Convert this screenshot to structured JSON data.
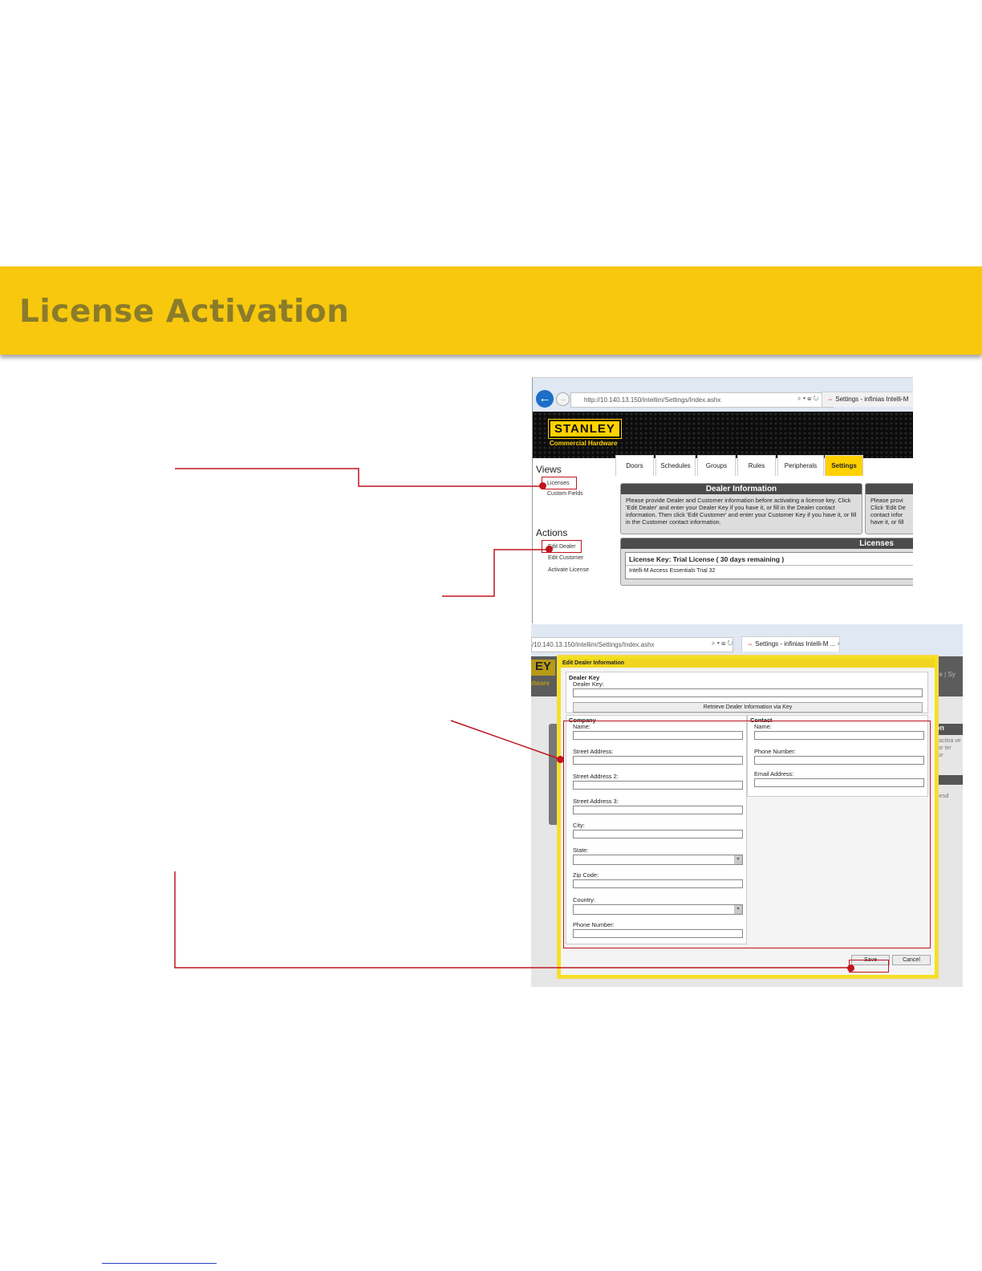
{
  "banner": {
    "title": "License Activation"
  },
  "screen1": {
    "address": "http://10.140.13.150/intellim/Settings/Index.ashx",
    "address_host": "10.140.13.150",
    "tab_title": "Settings - infinias Intelli-M",
    "logo": "STANLEY",
    "logo_sub": "Commercial Hardware",
    "views_heading": "Views",
    "views_items": [
      "Licenses",
      "Custom Fields"
    ],
    "actions_heading": "Actions",
    "actions_items": [
      "Edit Dealer",
      "Edit Customer",
      "Activate License"
    ],
    "nav_tabs": [
      "Doors",
      "Schedules",
      "Groups",
      "Rules",
      "Peripherals",
      "Settings"
    ],
    "active_tab": "Settings",
    "dealer_panel": {
      "title": "Dealer Information",
      "text": "Please provide Dealer and Customer information before activating a license key. Click 'Edit Dealer' and enter your Dealer Key if you have it, or fill in the Dealer contact information. Then click 'Edit Customer' and enter your Customer Key if you have it, or fill in the Customer contact information."
    },
    "customer_panel_text": "Please provi Click 'Edit De contact infor have it, or fill",
    "licenses_panel": {
      "title": "Licenses",
      "key_line": "License Key: Trial License ( 30 days remaining )",
      "product": "Intelli-M Access Essentials Trial 32"
    }
  },
  "screen2": {
    "address": "/10.140.13.150/intellim/Settings/Index.ashx",
    "tab_title": "Settings - infinias Intelli-M ...",
    "tab_close": "×",
    "bg_logo": "EY",
    "bg_logo_sub": "dware",
    "bg_right_top": "ne | Sy",
    "bg_right_panel_title": "on",
    "bg_right_panel_text": "re activa ve it, or ter your",
    "bg_right_panel2_text": "dnesd",
    "dialog": {
      "title": "Edit Dealer Information",
      "dealer_key_section": "Dealer Key",
      "dealer_key_label": "Dealer Key:",
      "retrieve_button": "Retrieve Dealer Information via Key",
      "company_section": "Company",
      "company_fields": [
        "Name:",
        "Street Address:",
        "Street Address 2:",
        "Street Address 3:",
        "City:",
        "State:",
        "Zip Code:",
        "Country:",
        "Phone Number:"
      ],
      "contact_section": "Contact",
      "contact_fields": [
        "Name:",
        "Phone Number:",
        "Email Address:"
      ],
      "save_button": "Save",
      "cancel_button": "Cancel"
    }
  },
  "colors": {
    "banner": "#f8c80e",
    "banner_text": "#8b7c29",
    "highlight": "#c0141e",
    "stanley_yellow": "#ffd100"
  }
}
